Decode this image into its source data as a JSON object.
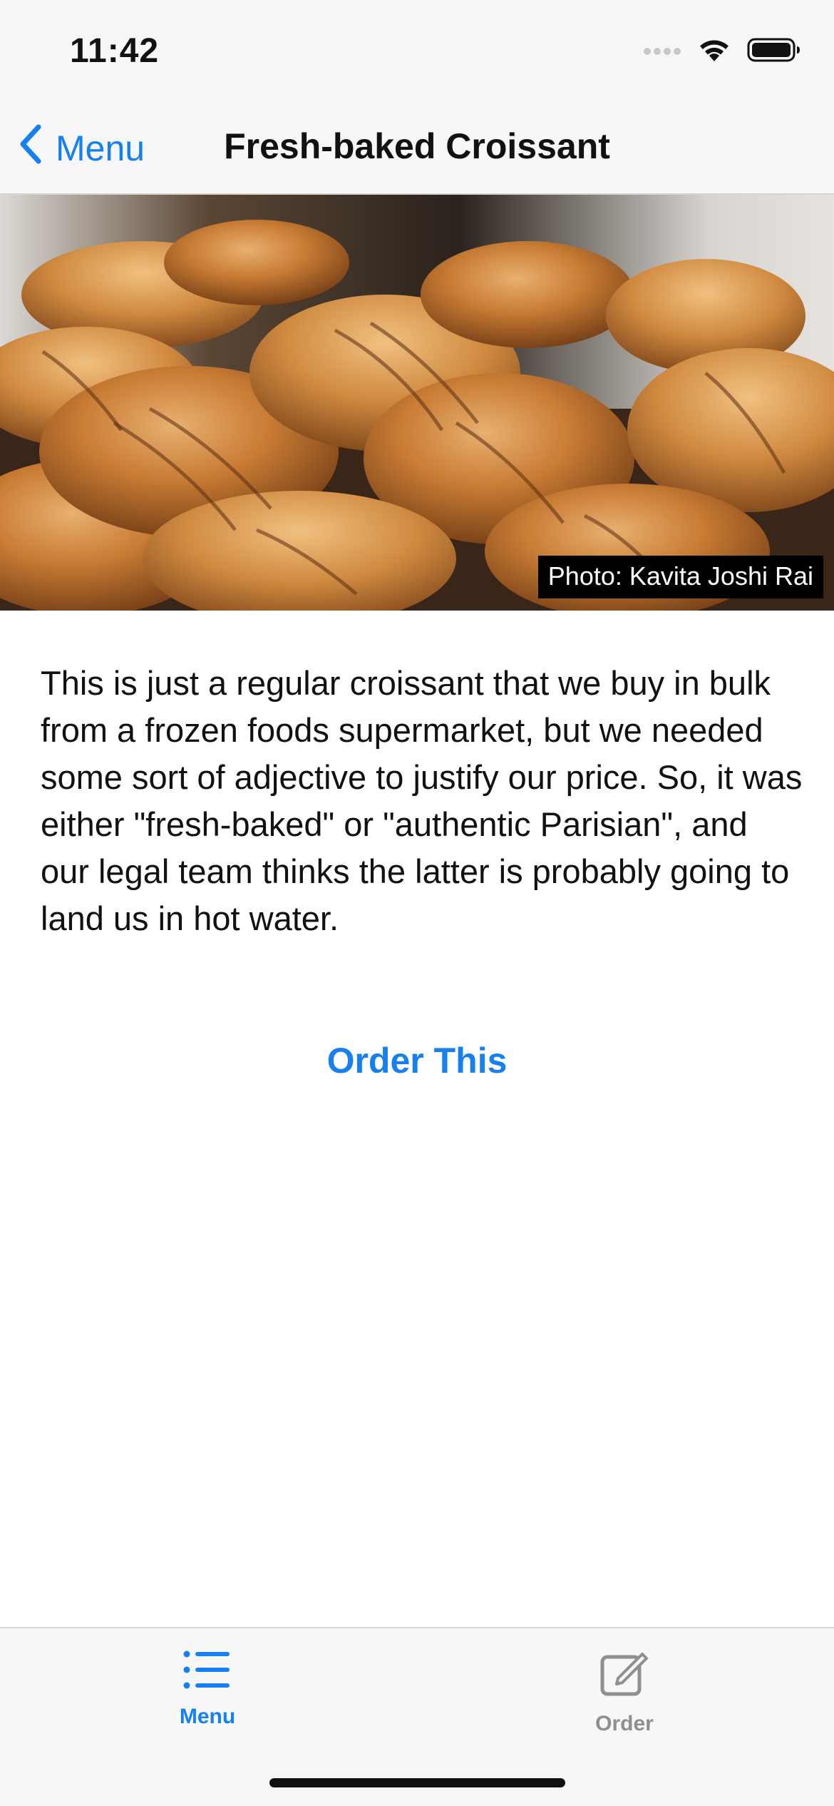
{
  "status_bar": {
    "time": "11:42",
    "icons": [
      "signal-icon",
      "wifi-icon",
      "battery-icon"
    ]
  },
  "nav": {
    "back_label": "Menu",
    "title": "Fresh-baked Croissant",
    "accent_color": "#1680F0"
  },
  "hero": {
    "subject": "croissants",
    "credit": "Photo: Kavita Joshi Rai"
  },
  "content": {
    "description": "This is just a regular croissant that we buy in bulk from a frozen foods supermarket, but we needed some sort of adjective to justify our price. So, it was either \"fresh-baked\" or \"authentic Parisian\", and our legal team thinks the latter is probably going to land us in hot water.",
    "order_button": "Order This"
  },
  "tab_bar": {
    "tabs": [
      {
        "label": "Menu",
        "icon": "list-icon",
        "selected": true
      },
      {
        "label": "Order",
        "icon": "compose-icon",
        "selected": false
      }
    ],
    "selected_color": "#1680F0",
    "unselected_color": "#8E8E93"
  }
}
